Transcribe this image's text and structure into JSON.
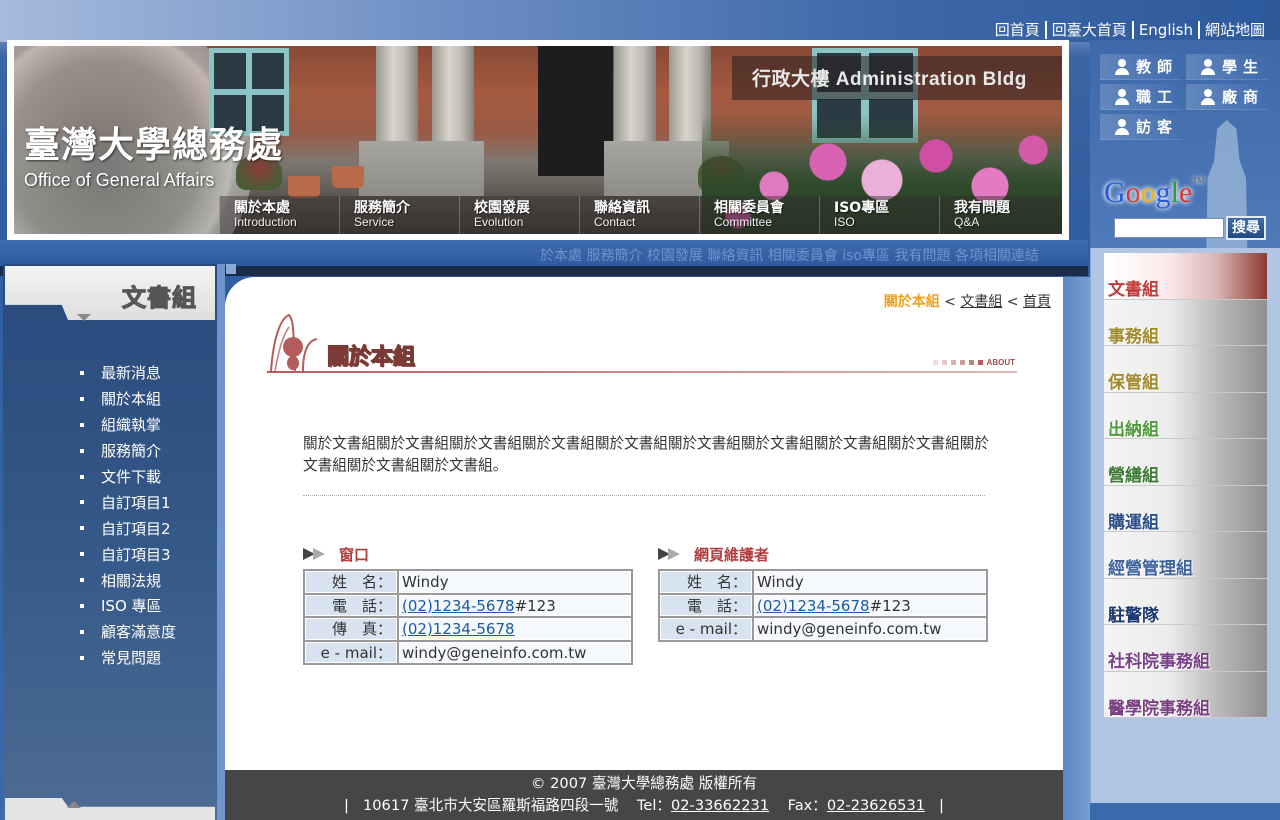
{
  "top_links": [
    "回首頁",
    "回臺大首頁",
    "English",
    "網站地圖"
  ],
  "banner": {
    "logo_cn": "臺灣大學總務處",
    "logo_en": "Office of General Affairs",
    "caption": "行政大樓  Administration Bldg",
    "nav": [
      {
        "cn": "關於本處",
        "en": "Introduction"
      },
      {
        "cn": "服務簡介",
        "en": "Service"
      },
      {
        "cn": "校園發展",
        "en": "Evolution"
      },
      {
        "cn": "聯絡資訊",
        "en": "Contact"
      },
      {
        "cn": "相關委員會",
        "en": "Committee"
      },
      {
        "cn": "ISO專區",
        "en": "ISO"
      },
      {
        "cn": "我有問題",
        "en": "Q&A"
      }
    ]
  },
  "marquee": "於本處 服務簡介 校園發展 聯絡資訊 相關委員會 iso專區 我有問題 各項相關連結",
  "audience": [
    "教師",
    "學生",
    "職工",
    "廠商",
    "訪客"
  ],
  "google": {
    "logo": "Google",
    "tm": "TM",
    "input_value": "",
    "button": "搜尋"
  },
  "units": [
    {
      "label": "文書組",
      "color": "#c0393b"
    },
    {
      "label": "事務組",
      "color": "#a08a2c"
    },
    {
      "label": "保管組",
      "color": "#a08a2c"
    },
    {
      "label": "出納組",
      "color": "#4f9a3a"
    },
    {
      "label": "營繕組",
      "color": "#3d7a35"
    },
    {
      "label": "購運組",
      "color": "#2d4f8a"
    },
    {
      "label": "經營管理組",
      "color": "#3f64a0"
    },
    {
      "label": "駐警隊",
      "color": "#1f3a70"
    },
    {
      "label": "社科院事務組",
      "color": "#7a3f88"
    },
    {
      "label": "醫學院事務組",
      "color": "#7a3f80"
    }
  ],
  "left": {
    "title": "文書組",
    "menu": [
      "最新消息",
      "關於本組",
      "組織執掌",
      "服務簡介",
      "文件下載",
      "自訂項目1",
      "自訂項目2",
      "自訂項目3",
      "相關法規",
      " ISO 專區",
      "顧客滿意度",
      "常見問題"
    ]
  },
  "breadcrumb": {
    "current": "關於本組",
    "sep": " < ",
    "parent": "文書組",
    "home": "首頁"
  },
  "section": {
    "title": "關於本組",
    "tag": "ABOUT"
  },
  "intro": "關於文書組關於文書組關於文書組關於文書組關於文書組關於文書組關於文書組關於文書組關於文書組關於文書組關於文書組關於文書組。",
  "contacts": [
    {
      "title": "窗口",
      "rows": [
        {
          "label": "姓　名：",
          "value": "Windy"
        },
        {
          "label": "電　話：",
          "link": "(02)1234-5678",
          "suffix": "#123"
        },
        {
          "label": "傳　真：",
          "link": "(02)1234-5678",
          "suffix": ""
        },
        {
          "label": "e - mail：",
          "value": "windy@geneinfo.com.tw"
        }
      ]
    },
    {
      "title": "網頁維護者",
      "rows": [
        {
          "label": "姓　名：",
          "value": "Windy"
        },
        {
          "label": "電　話：",
          "link": "(02)1234-5678",
          "suffix": "#123"
        },
        {
          "label": "e - mail：",
          "value": "windy@geneinfo.com.tw"
        }
      ]
    }
  ],
  "footer": {
    "copyright": "© 2007 臺灣大學總務處 版權所有",
    "address": "10617 臺北市大安區羅斯福路四段一號",
    "tel_label": "Tel：",
    "tel": "02-33662231",
    "fax_label": "Fax：",
    "fax": "02-23626531"
  },
  "colors": {
    "breadcrumb_current": "#f0a020",
    "section_title": "#7b3a36",
    "link": "#1a5aa6",
    "footer_bg": "#464646"
  }
}
